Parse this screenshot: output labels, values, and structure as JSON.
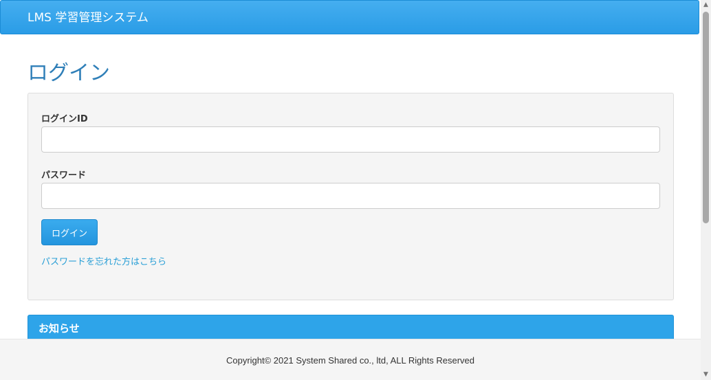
{
  "header": {
    "brand": "LMS 学習管理システム"
  },
  "page": {
    "title": "ログイン"
  },
  "login_form": {
    "id_label": "ログインID",
    "id_value": "",
    "password_label": "パスワード",
    "password_value": "",
    "submit_label": "ログイン",
    "forgot_link": "パスワードを忘れた方はこちら"
  },
  "news": {
    "title": "お知らせ"
  },
  "footer": {
    "copyright": "Copyright© 2021 System Shared co., ltd, ALL Rights Reserved"
  },
  "scrollbar": {
    "up_icon": "▲",
    "down_icon": "▼"
  },
  "colors": {
    "primary": "#2ea4e9",
    "title": "#2f7fb8",
    "link": "#2a9fd6"
  }
}
